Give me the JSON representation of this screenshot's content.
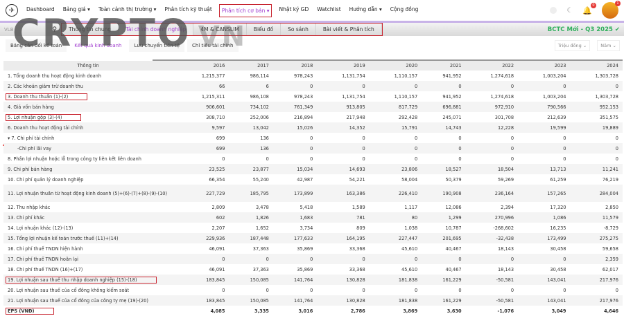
{
  "watermark": {
    "main": "CRYPTO",
    "suffix": "VN"
  },
  "nav": {
    "items": [
      "Dashboard",
      "Bảng giá ▾",
      "Toàn cảnh thị trường ▾",
      "Phân tích kỹ thuật",
      "Phân tích cơ bản ▾",
      "Nhật ký GD",
      "Watchlist",
      "Hướng dẫn ▾",
      "Cộng đồng"
    ],
    "active_index": 4,
    "notification_count": "0",
    "avatar_badge": "1"
  },
  "toolbar": {
    "search_value": "VLB",
    "tabs": [
      "Thông tin chung",
      "Tài chính doanh nghiệp",
      "4M & CANSLIM",
      "Biểu đồ",
      "So sánh",
      "Bài viết & Phân tích"
    ],
    "active_tab": 1,
    "status": "BCTC Mới - Q3 2025 ✔"
  },
  "subtabs": {
    "items": [
      "Bảng cân đối kế toán",
      "Kết quả kinh doanh",
      "Lưu chuyển tiền tệ",
      "Chỉ tiêu tài chính"
    ],
    "active_index": 1,
    "unit": "Triệu đồng ⌄",
    "period": "Năm ⌄"
  },
  "table": {
    "header": [
      "Thông tin",
      "2016",
      "2017",
      "2018",
      "2019",
      "2020",
      "2021",
      "2022",
      "2023",
      "2024"
    ],
    "rows": [
      [
        "1. Tổng doanh thu hoạt động kinh doanh",
        "1,215,377",
        "986,114",
        "978,243",
        "1,131,754",
        "1,110,157",
        "941,952",
        "1,274,618",
        "1,003,204",
        "1,303,728"
      ],
      [
        "2. Các khoản giảm trừ doanh thu",
        "66",
        "6",
        "0",
        "0",
        "0",
        "0",
        "0",
        "0",
        "0"
      ],
      [
        "3. Doanh thu thuần (1)-(2)",
        "1,215,311",
        "986,108",
        "978,243",
        "1,131,754",
        "1,110,157",
        "941,952",
        "1,274,618",
        "1,003,204",
        "1,303,728"
      ],
      [
        "4. Giá vốn bán hàng",
        "906,601",
        "734,102",
        "761,349",
        "913,805",
        "817,729",
        "696,881",
        "972,910",
        "790,566",
        "952,153"
      ],
      [
        "5. Lợi nhuận gộp (3)-(4)",
        "308,710",
        "252,006",
        "216,894",
        "217,948",
        "292,428",
        "245,071",
        "301,708",
        "212,639",
        "351,575"
      ],
      [
        "6. Doanh thu hoạt động tài chính",
        "9,597",
        "13,042",
        "15,026",
        "14,352",
        "15,791",
        "14,743",
        "12,228",
        "19,599",
        "19,889"
      ],
      [
        "▾ 7. Chi phí tài chính",
        "699",
        "136",
        "0",
        "0",
        "0",
        "0",
        "0",
        "0",
        "0"
      ],
      [
        "-Chi phí lãi vay",
        "699",
        "136",
        "0",
        "0",
        "0",
        "0",
        "0",
        "0",
        "0"
      ],
      [
        "8. Phần lợi nhuận hoặc lỗ trong công ty liên kết liên doanh",
        "0",
        "0",
        "0",
        "0",
        "0",
        "0",
        "0",
        "0",
        "0"
      ],
      [
        "9. Chi phí bán hàng",
        "23,525",
        "23,877",
        "15,034",
        "14,693",
        "23,806",
        "18,527",
        "18,504",
        "13,713",
        "11,241"
      ],
      [
        "10. Chi phí quản lý doanh nghiệp",
        "66,354",
        "55,240",
        "42,987",
        "54,221",
        "58,004",
        "50,379",
        "59,269",
        "61,259",
        "76,219"
      ],
      [
        "11. Lợi nhuận thuần từ hoạt động kinh doanh (5)+(6)-(7)+(8)-(9)-(10)",
        "227,729",
        "185,795",
        "173,899",
        "163,386",
        "226,410",
        "190,908",
        "236,164",
        "157,265",
        "284,004"
      ],
      [
        "12. Thu nhập khác",
        "2,809",
        "3,478",
        "5,418",
        "1,589",
        "1,117",
        "12,086",
        "2,394",
        "17,320",
        "2,850"
      ],
      [
        "13. Chi phí khác",
        "602",
        "1,826",
        "1,683",
        "781",
        "80",
        "1,299",
        "270,996",
        "1,086",
        "11,579"
      ],
      [
        "14. Lợi nhuận khác (12)-(13)",
        "2,207",
        "1,652",
        "3,734",
        "809",
        "1,038",
        "10,787",
        "-268,602",
        "16,235",
        "-8,729"
      ],
      [
        "15. Tổng lợi nhuận kế toán trước thuế (11)+(14)",
        "229,936",
        "187,448",
        "177,633",
        "164,195",
        "227,447",
        "201,695",
        "-32,438",
        "173,499",
        "275,275"
      ],
      [
        "16. Chi phí thuế TNDN hiện hành",
        "46,091",
        "37,363",
        "35,869",
        "33,368",
        "45,610",
        "40,467",
        "18,143",
        "30,458",
        "59,658"
      ],
      [
        "17. Chi phí thuế TNDN hoãn lại",
        "0",
        "0",
        "0",
        "0",
        "0",
        "0",
        "0",
        "0",
        "2,359"
      ],
      [
        "18. Chi phí thuế TNDN (16)+(17)",
        "46,091",
        "37,363",
        "35,869",
        "33,368",
        "45,610",
        "40,467",
        "18,143",
        "30,458",
        "62,017"
      ],
      [
        "19. Lợi nhuận sau thuế thu nhập doanh nghiệp (15)-(18)",
        "183,845",
        "150,085",
        "141,764",
        "130,828",
        "181,838",
        "161,229",
        "-50,581",
        "143,041",
        "217,976"
      ],
      [
        "20. Lợi nhuận sau thuế của cổ đông không kiểm soát",
        "0",
        "0",
        "0",
        "0",
        "0",
        "0",
        "0",
        "0",
        "0"
      ],
      [
        "21. Lợi nhuận sau thuế của cổ đông của công ty mẹ (19)-(20)",
        "183,845",
        "150,085",
        "141,764",
        "130,828",
        "181,838",
        "161,229",
        "-50,581",
        "143,041",
        "217,976"
      ],
      [
        "EPS (VNĐ)",
        "4,085",
        "3,335",
        "3,016",
        "2,786",
        "3,869",
        "3,630",
        "-1,076",
        "3,049",
        "4,646"
      ]
    ],
    "highlighted_rows": [
      2,
      4,
      19,
      22
    ]
  }
}
